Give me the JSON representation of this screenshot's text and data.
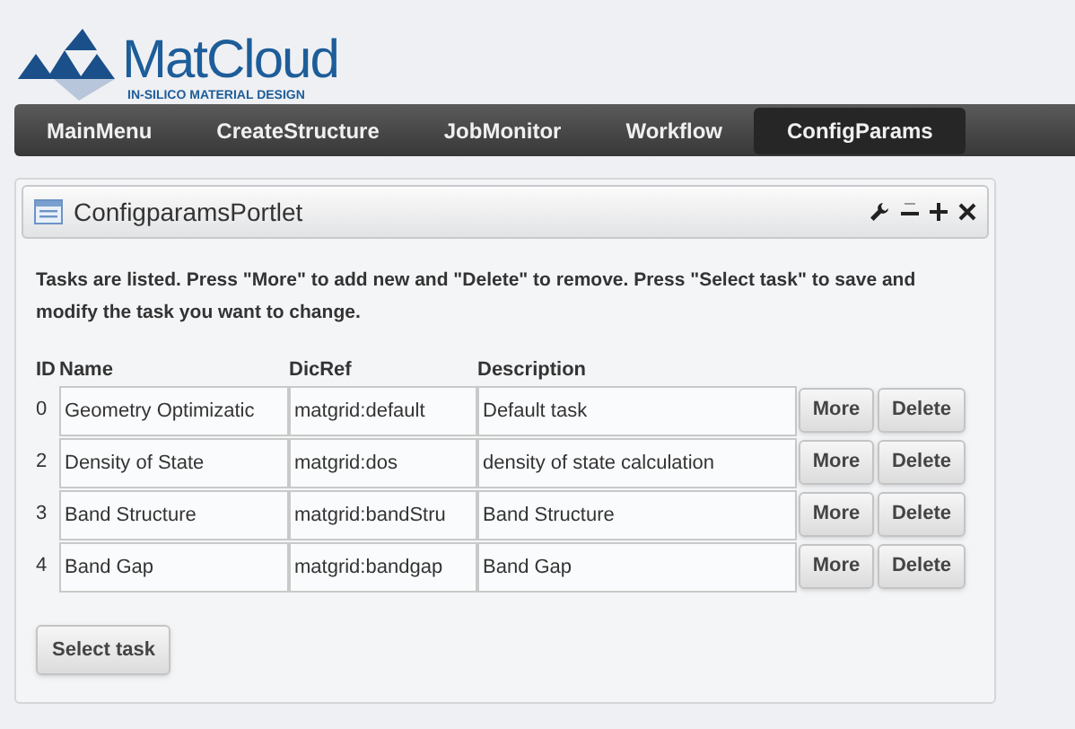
{
  "logo": {
    "title": "MatCloud",
    "subtitle": "IN-SILICO MATERIAL DESIGN"
  },
  "nav": [
    {
      "label": "MainMenu",
      "selected": false
    },
    {
      "label": "CreateStructure",
      "selected": false
    },
    {
      "label": "JobMonitor",
      "selected": false
    },
    {
      "label": "Workflow",
      "selected": false
    },
    {
      "label": "ConfigParams",
      "selected": true
    }
  ],
  "portlet": {
    "title": "ConfigparamsPortlet",
    "intro": "Tasks are listed. Press \"More\" to add new and \"Delete\" to remove. Press \"Select task\" to save and modify the task you want to change.",
    "columns": [
      "ID",
      "Name",
      "DicRef",
      "Description"
    ],
    "rows": [
      {
        "id": "0",
        "name": "Geometry Optimizatic",
        "dicref": "matgrid:default",
        "description": "Default task",
        "more": "More",
        "delete": "Delete"
      },
      {
        "id": "2",
        "name": "Density of State",
        "dicref": "matgrid:dos",
        "description": "density of state calculation",
        "more": "More",
        "delete": "Delete"
      },
      {
        "id": "3",
        "name": "Band Structure",
        "dicref": "matgrid:bandStru",
        "description": "Band Structure",
        "more": "More",
        "delete": "Delete"
      },
      {
        "id": "4",
        "name": "Band Gap",
        "dicref": "matgrid:bandgap",
        "description": "Band Gap",
        "more": "More",
        "delete": "Delete"
      }
    ],
    "select_button": "Select task"
  }
}
